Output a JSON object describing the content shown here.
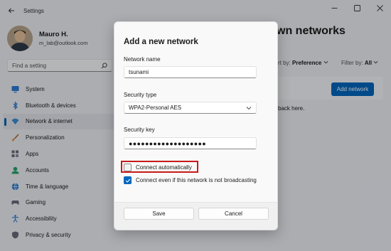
{
  "window": {
    "title": "Settings",
    "accent": "#0067c0"
  },
  "profile": {
    "name": "Mauro H.",
    "email": "m_lab@outlook.com"
  },
  "search": {
    "placeholder": "Find a setting"
  },
  "nav": [
    {
      "label": "System",
      "icon": "monitor-icon",
      "active": false
    },
    {
      "label": "Bluetooth & devices",
      "icon": "bluetooth-icon",
      "active": false
    },
    {
      "label": "Network & internet",
      "icon": "wifi-icon",
      "active": true
    },
    {
      "label": "Personalization",
      "icon": "brush-icon",
      "active": false
    },
    {
      "label": "Apps",
      "icon": "apps-icon",
      "active": false
    },
    {
      "label": "Accounts",
      "icon": "person-icon",
      "active": false
    },
    {
      "label": "Time & language",
      "icon": "globe-icon",
      "active": false
    },
    {
      "label": "Gaming",
      "icon": "gamepad-icon",
      "active": false
    },
    {
      "label": "Accessibility",
      "icon": "accessibility-icon",
      "active": false
    },
    {
      "label": "Privacy & security",
      "icon": "shield-icon",
      "active": false
    }
  ],
  "main": {
    "title": "wn networks",
    "sort_label": "rt by:",
    "sort_value": "Preference",
    "filter_label": "Filter by:",
    "filter_value": "All",
    "add_network_button": "Add network",
    "back_text": "back here."
  },
  "dialog": {
    "title": "Add a new network",
    "network_name_label": "Network name",
    "network_name_value": "tsunami",
    "security_type_label": "Security type",
    "security_type_value": "WPA2-Personal AES",
    "security_key_label": "Security key",
    "security_key_value": "●●●●●●●●●●●●●●●●●●●",
    "connect_auto_label": "Connect automatically",
    "connect_auto_checked": false,
    "connect_hidden_label": "Connect even if this network is not broadcasting",
    "connect_hidden_checked": true,
    "save_button": "Save",
    "cancel_button": "Cancel"
  }
}
